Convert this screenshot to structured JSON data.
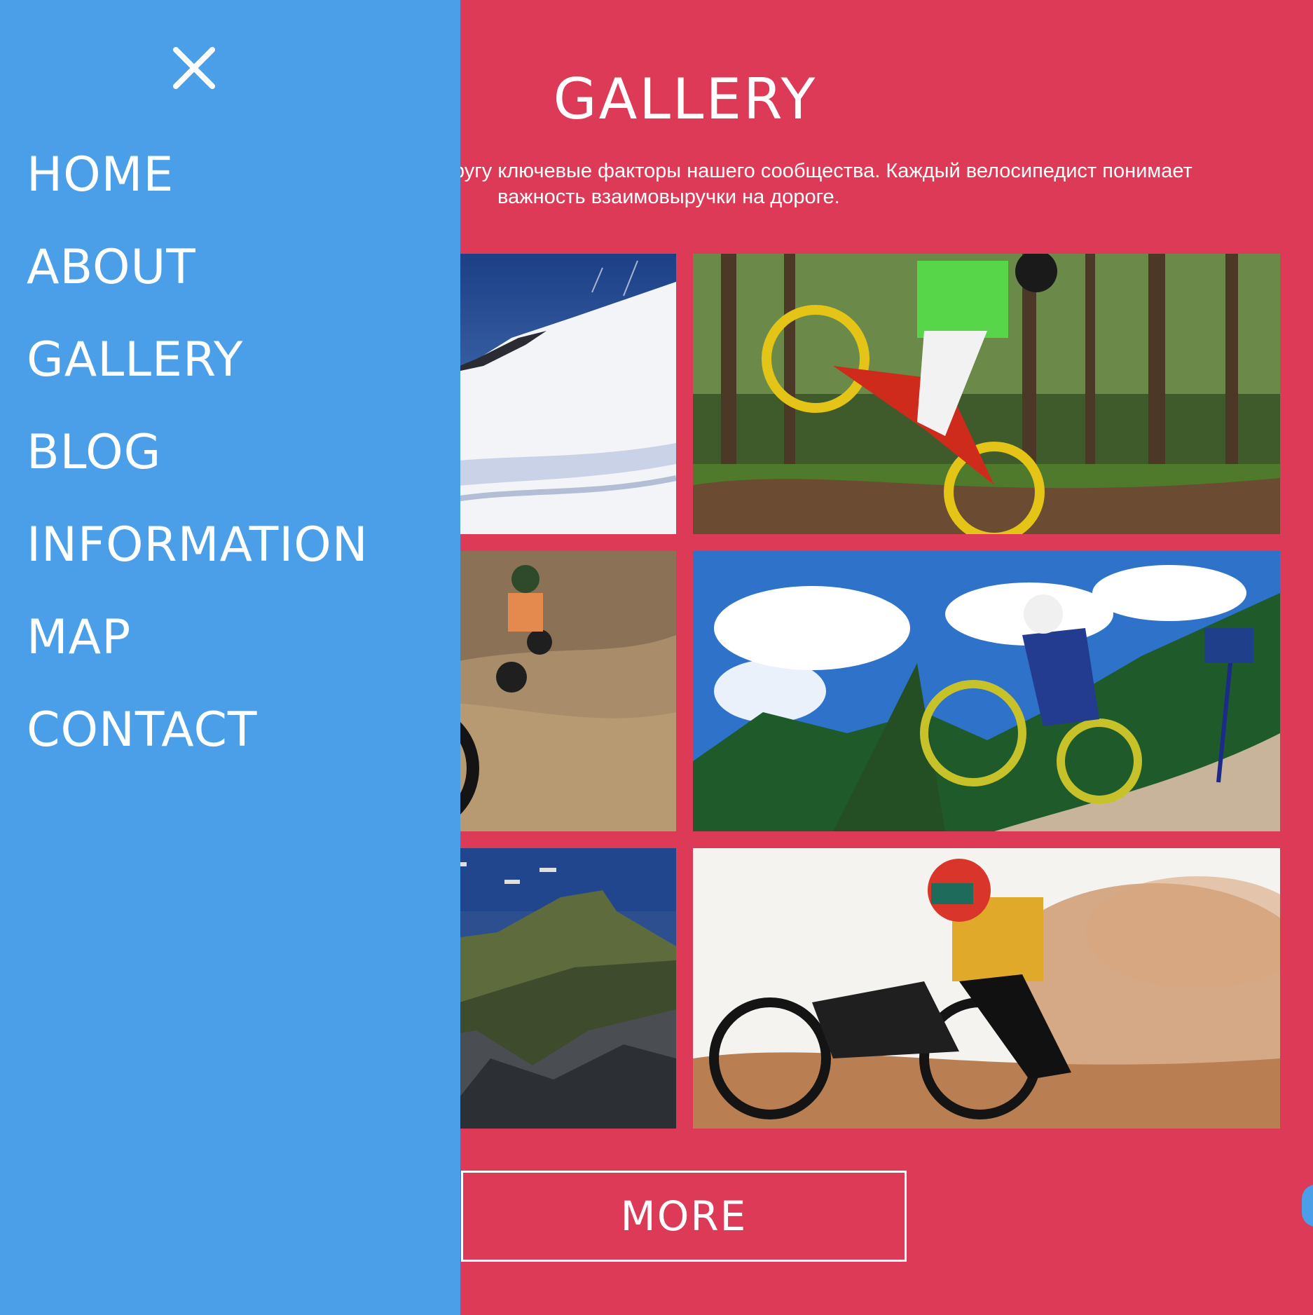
{
  "gallery": {
    "title": "GALLERY",
    "intro_line_1": "другу ключевые факторы нашего сообщества. Каждый велосипедист понимает",
    "intro_line_2": "важность взаимовыручки на дороге.",
    "photos": [
      {
        "name": "snow-slope-photo"
      },
      {
        "name": "forest-jump-photo"
      },
      {
        "name": "dirt-trail-photo"
      },
      {
        "name": "sky-jump-photo"
      },
      {
        "name": "coastal-cliff-photo"
      },
      {
        "name": "dust-rider-photo"
      }
    ],
    "more_label": "MORE"
  },
  "menu": {
    "close_icon": "close-icon",
    "items": [
      {
        "label": "HOME"
      },
      {
        "label": "ABOUT"
      },
      {
        "label": "GALLERY"
      },
      {
        "label": "BLOG"
      },
      {
        "label": "INFORMATION"
      },
      {
        "label": "MAP"
      },
      {
        "label": "CONTACT"
      }
    ]
  },
  "colors": {
    "page_background": "#dc3a56",
    "menu_background": "#4a9fe8",
    "text": "#ffffff"
  }
}
